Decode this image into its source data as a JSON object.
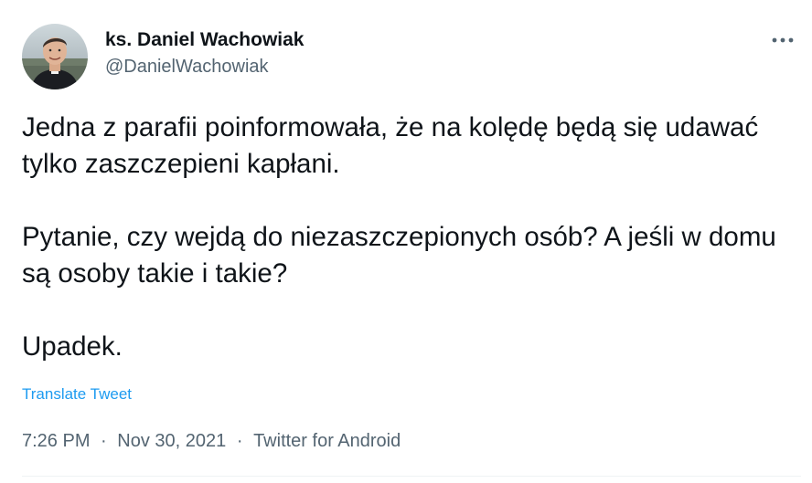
{
  "author": {
    "display_name": "ks. Daniel Wachowiak",
    "handle": "@DanielWachowiak",
    "avatar_icon": "profile-photo"
  },
  "tweet": {
    "paragraphs": [
      "Jedna z parafii poinformowała, że na kolędę będą się udawać tylko zaszczepieni kapłani.",
      "Pytanie, czy wejdą do niezaszczepionych osób? A jeśli w domu są osoby takie i takie?",
      "Upadek."
    ],
    "translate_label": "Translate Tweet"
  },
  "meta": {
    "time": "7:26 PM",
    "separator": "·",
    "date": "Nov 30, 2021",
    "source": "Twitter for Android"
  },
  "colors": {
    "text": "#0f1419",
    "secondary": "#536471",
    "accent": "#1d9bf0",
    "divider": "#eff3f4"
  },
  "icons": {
    "more": "more-horizontal-icon"
  }
}
